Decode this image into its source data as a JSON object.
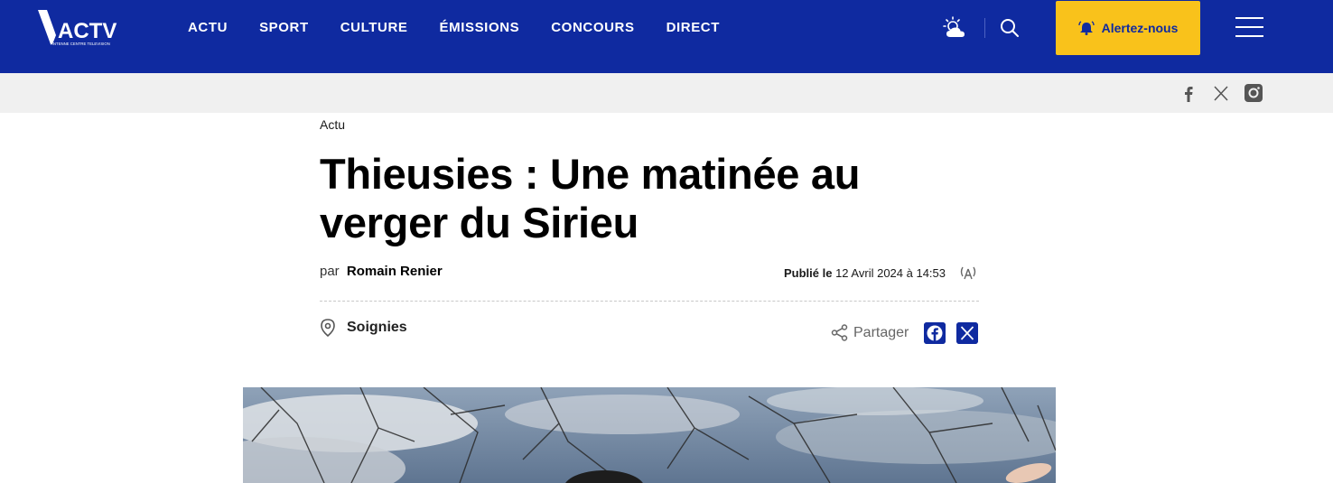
{
  "header": {
    "logo_text": "ACTV",
    "logo_subtext": "ANTENNE CENTRE TELEVISION",
    "nav": [
      "ACTU",
      "SPORT",
      "CULTURE",
      "ÉMISSIONS",
      "CONCOURS",
      "DIRECT"
    ],
    "alert_label": "Alertez-nous",
    "icons": [
      "weather-icon",
      "search-icon",
      "bell-icon",
      "menu-icon"
    ]
  },
  "social_bar": {
    "icons": [
      "facebook-icon",
      "x-icon",
      "instagram-icon"
    ]
  },
  "article": {
    "category": "Actu",
    "title": "Thieusies : Une matinée au verger du Sirieu",
    "by_prefix": "par",
    "author": "Romain Renier",
    "published_prefix": "Publié le",
    "published_date": "12 Avril 2024 à 14:53",
    "location": "Soignies",
    "share_label": "Partager"
  },
  "colors": {
    "brand_blue": "#0f2aa0",
    "accent_yellow": "#f9c21b",
    "subbar_gray": "#f0f0f0"
  }
}
